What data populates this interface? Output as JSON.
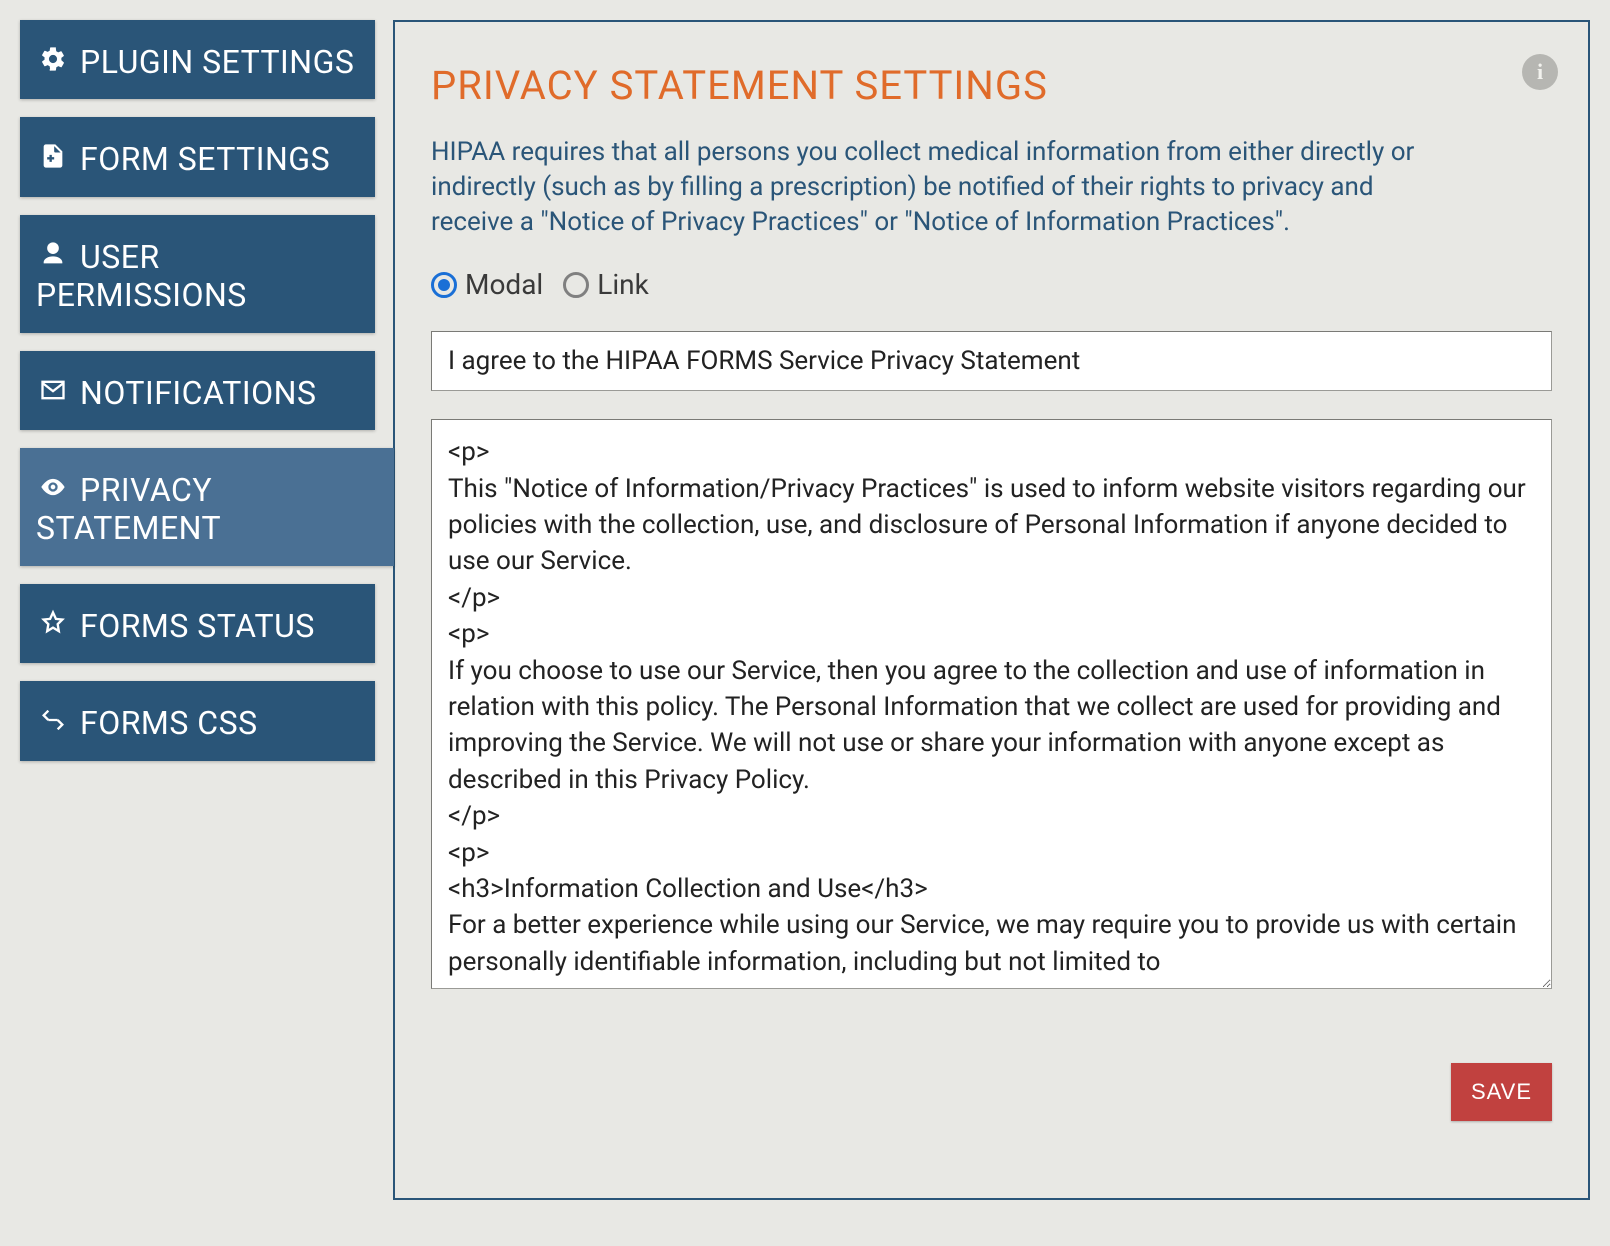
{
  "sidebar": {
    "items": [
      {
        "label": "PLUGIN SETTINGS",
        "icon": "gear-icon"
      },
      {
        "label": "FORM SETTINGS",
        "icon": "file-plus-icon"
      },
      {
        "label": "USER PERMISSIONS",
        "icon": "user-icon"
      },
      {
        "label": "NOTIFICATIONS",
        "icon": "envelope-icon"
      },
      {
        "label": "PRIVACY STATEMENT",
        "icon": "eye-icon"
      },
      {
        "label": "FORMS STATUS",
        "icon": "star-icon"
      },
      {
        "label": "FORMS CSS",
        "icon": "code-icon"
      }
    ]
  },
  "main": {
    "title": "PRIVACY STATEMENT SETTINGS",
    "intro": "HIPAA requires that all persons you collect medical information from either directly or indirectly (such as by filling a prescription) be notified of their rights to privacy and receive a \"Notice of Privacy Practices\" or \"Notice of Information Practices\".",
    "display_mode": {
      "options": [
        "Modal",
        "Link"
      ],
      "selected": "Modal"
    },
    "agree_text": "I agree to the HIPAA FORMS Service Privacy Statement",
    "policy_html": "<p>\nThis \"Notice of Information/Privacy Practices\" is used to inform website visitors regarding our policies with the collection, use, and disclosure of Personal Information if anyone decided to use our Service.\n</p>\n<p>\nIf you choose to use our Service, then you agree to the collection and use of information in relation with this policy. The Personal Information that we collect are used for providing and improving the Service. We will not use or share your information with anyone except as described in this Privacy Policy.\n</p>\n<p>\n<h3>Information Collection and Use</h3>\nFor a better experience while using our Service, we may require you to provide us with certain personally identifiable information, including but not limited to",
    "save_label": "SAVE",
    "info_label": "i"
  }
}
